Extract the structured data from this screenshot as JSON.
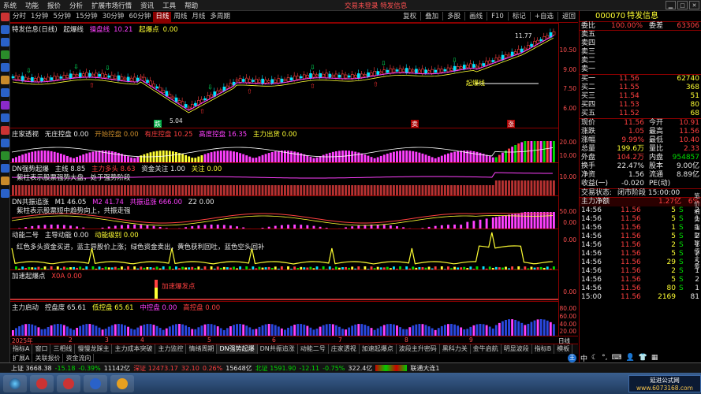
{
  "menu": {
    "items": [
      "系统",
      "功能",
      "报价",
      "分析",
      "扩展市场行情",
      "资讯",
      "工具",
      "帮助"
    ],
    "notice": "交易未登录  特发信息"
  },
  "toolbar": {
    "periods": [
      "分时",
      "1分钟",
      "5分钟",
      "15分钟",
      "30分钟",
      "60分钟",
      "日线",
      "周线",
      "月线",
      "多周期"
    ],
    "active_period": "日线",
    "right_buttons": [
      "复权",
      "叠加",
      "多股",
      "画线",
      "F10",
      "标记",
      "+自选",
      "返回"
    ]
  },
  "main_chart": {
    "title": "特发信息(日线)",
    "ind1": "起爆线",
    "ind2": "操盘线",
    "ind2_value": "10.21",
    "ind3": "起爆点",
    "ind3_value": "0.00",
    "high_label": "11.77",
    "low_label": "5.04",
    "mark_qibao": "起爆线",
    "mark_die": "跌",
    "mark_mai": "卖",
    "mark_zhang": "涨",
    "y_ticks": [
      "10.50",
      "9.00",
      "7.50",
      "6.00"
    ]
  },
  "panel_zhuangjia": {
    "title": "庄家透视",
    "items": [
      "无庄控盘 0.00",
      "开始控盘 0.00",
      "有庄控盘 10.25",
      "高度控盘 16.35",
      "主力出货 0.00"
    ],
    "y_ticks": [
      "20.00",
      "10.00"
    ]
  },
  "panel_dnqibao": {
    "title": "DN强势起爆",
    "items": [
      "主线 8.85",
      "主力多头 8.63",
      "资金关注 1.00",
      "关注 0.00"
    ],
    "note": "紫柱表示股票强势大盘，处于强势阶段",
    "y_ticks": [
      "10.00"
    ]
  },
  "panel_gongzhen": {
    "title": "DN共振追涨",
    "items": [
      "M1 46.05",
      "M2 41.74",
      "共振追涨 666.00",
      "Z2 0.00"
    ],
    "note": "紫柱表示股票短中趋势向上，共振走强",
    "y_ticks": [
      "50.00",
      "0.00"
    ]
  },
  "panel_dongneng": {
    "title": "动能二号",
    "items": [
      "主导动能 0.00",
      "动能级别 0.00"
    ],
    "note": "红色多头资金买进，蓝主导股价上涨；绿色资金卖出，黄色获利回吐，蓝色空头回补",
    "y_ticks": [
      "0.00"
    ]
  },
  "panel_jiasu": {
    "title": "加速起爆点",
    "items": [
      "X0A 0.00"
    ],
    "mark": "加速爆发点",
    "y_ticks": [
      "0.00"
    ]
  },
  "panel_zhuli": {
    "title": "主力启动",
    "items": [
      "控盘度 65.61",
      "低控盘 65.61",
      "中控盘 0.00",
      "高控盘 0.00"
    ],
    "y_ticks": [
      "80.00",
      "60.00",
      "40.00",
      "20.00"
    ]
  },
  "dates": [
    "2025年",
    "2",
    "3",
    "4",
    "5",
    "6",
    "7",
    "8",
    "9"
  ],
  "bottom_tabs": [
    "指标A",
    "窗口",
    "三相线",
    "慢慢龙踩主",
    "主力成本突破",
    "主力监控",
    "情绪周期",
    "DN强势起爆",
    "DN共振追涨",
    "动能二号",
    "庄家透视",
    "加速起爆点",
    "波段主升密码",
    "黑科力关",
    "金牛启航",
    "明显波段",
    "指标B",
    "模板"
  ],
  "sub_tabs": [
    "扩展A",
    "关联报价",
    "资金流向"
  ],
  "quote": {
    "code": "000070",
    "name": "特发信息",
    "weibi_label": "委比",
    "weibi": "100.00%",
    "weicha_label": "委差",
    "weicha": "63306",
    "sell": [
      {
        "label": "卖五",
        "price": "",
        "vol": ""
      },
      {
        "label": "卖四",
        "price": "",
        "vol": ""
      },
      {
        "label": "卖三",
        "price": "",
        "vol": ""
      },
      {
        "label": "卖二",
        "price": "",
        "vol": ""
      },
      {
        "label": "卖一",
        "price": "",
        "vol": ""
      }
    ],
    "buy": [
      {
        "label": "买一",
        "price": "11.56",
        "vol": "62740"
      },
      {
        "label": "买二",
        "price": "11.55",
        "vol": "368"
      },
      {
        "label": "买三",
        "price": "11.54",
        "vol": "51"
      },
      {
        "label": "买四",
        "price": "11.53",
        "vol": "80"
      },
      {
        "label": "买五",
        "price": "11.52",
        "vol": "68"
      }
    ],
    "stats": [
      {
        "l1": "现价",
        "v1": "11.56",
        "l2": "今开",
        "v2": "10.91"
      },
      {
        "l1": "涨跌",
        "v1": "1.05",
        "l2": "最高",
        "v2": "11.56"
      },
      {
        "l1": "涨幅",
        "v1": "9.99%",
        "l2": "最低",
        "v2": "10.40"
      },
      {
        "l1": "总量",
        "v1": "199.6万",
        "l2": "量比",
        "v2": "2.33"
      },
      {
        "l1": "外盘",
        "v1": "104.2万",
        "l2": "内盘",
        "v2": "954857"
      },
      {
        "l1": "换手",
        "v1": "22.47%",
        "l2": "股本",
        "v2": "9.00亿"
      },
      {
        "l1": "净资",
        "v1": "1.56",
        "l2": "流通",
        "v2": "8.89亿"
      },
      {
        "l1": "收益(一)",
        "v1": "-0.020",
        "l2": "PE(动)",
        "v2": ""
      }
    ],
    "status_label": "交易状态:",
    "status_value": "闭市阶段 15:00:00",
    "netflow_label": "主力净额",
    "netflow_value": "1.27亿",
    "netflow_pct": "6%",
    "ticks": [
      {
        "t": "14:56",
        "p": "11.56",
        "v": "5",
        "d": "S",
        "n": "2"
      },
      {
        "t": "14:56",
        "p": "11.56",
        "v": "5",
        "d": "S",
        "n": "1"
      },
      {
        "t": "14:56",
        "p": "11.56",
        "v": "1",
        "d": "S",
        "n": "1"
      },
      {
        "t": "14:56",
        "p": "11.56",
        "v": "5",
        "d": "S",
        "n": "2"
      },
      {
        "t": "14:56",
        "p": "11.56",
        "v": "2",
        "d": "S",
        "n": "1"
      },
      {
        "t": "14:56",
        "p": "11.56",
        "v": "5",
        "d": "S",
        "n": "2"
      },
      {
        "t": "14:56",
        "p": "11.56",
        "v": "29",
        "d": "S",
        "n": "5"
      },
      {
        "t": "14:56",
        "p": "11.56",
        "v": "2",
        "d": "S",
        "n": "1"
      },
      {
        "t": "14:56",
        "p": "11.56",
        "v": "5",
        "d": "S",
        "n": "2"
      },
      {
        "t": "14:56",
        "p": "11.56",
        "v": "80",
        "d": "S",
        "n": "1"
      },
      {
        "t": "15:00",
        "p": "11.56",
        "v": "2169",
        "d": "",
        "n": "81"
      }
    ],
    "bottom_labels": [
      "笔",
      "价",
      "细",
      "势",
      "指",
      "财",
      "联",
      "值",
      "主",
      "筹"
    ]
  },
  "statusbar": {
    "sh": "上证 3668.38",
    "sh_chg": "-15.18",
    "sh_pct": "-0.39%",
    "sh_amt": "11142亿",
    "sz": "深证 12473.17",
    "sz_chg": "32.10",
    "sz_pct": "0.26%",
    "sz_amt": "15648亿",
    "bz": "北证 1591.90",
    "bz_chg": "-12.11",
    "bz_pct": "-0.75%",
    "bz_amt": "322.4亿",
    "conn": "联通大连1"
  },
  "ime": {
    "label": "中"
  },
  "watermark": {
    "line1": "延进公式网",
    "line2": "www.6073168.com"
  },
  "colors": {
    "up": "#ff4040",
    "down": "#00dd00",
    "border": "#8b0000",
    "accent": "#ffff33",
    "purple": "#ff40ff"
  }
}
